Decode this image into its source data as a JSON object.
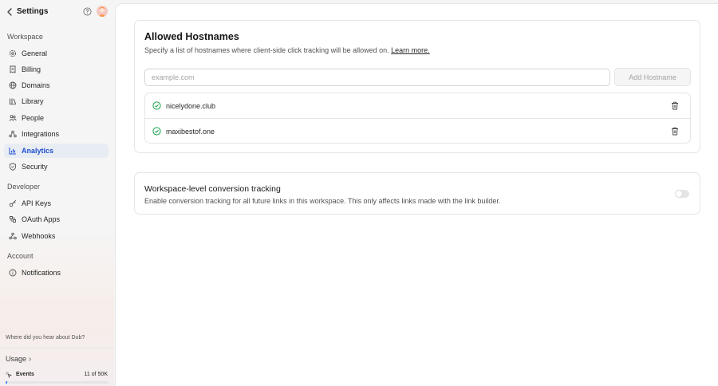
{
  "sidebar": {
    "title": "Settings",
    "sections": {
      "workspace": "Workspace",
      "developer": "Developer",
      "account": "Account"
    },
    "workspace_items": [
      {
        "label": "General",
        "icon": "gear-icon"
      },
      {
        "label": "Billing",
        "icon": "receipt-icon"
      },
      {
        "label": "Domains",
        "icon": "globe-icon"
      },
      {
        "label": "Library",
        "icon": "library-icon"
      },
      {
        "label": "People",
        "icon": "users-icon"
      },
      {
        "label": "Integrations",
        "icon": "integrations-icon"
      },
      {
        "label": "Analytics",
        "icon": "analytics-icon",
        "active": true
      },
      {
        "label": "Security",
        "icon": "shield-icon"
      }
    ],
    "developer_items": [
      {
        "label": "API Keys",
        "icon": "key-icon"
      },
      {
        "label": "OAuth Apps",
        "icon": "oauth-icon"
      },
      {
        "label": "Webhooks",
        "icon": "webhook-icon"
      }
    ],
    "account_items": [
      {
        "label": "Notifications",
        "icon": "bell-icon"
      }
    ],
    "hear_prompt": "Where did you hear about Dub?",
    "usage": {
      "label": "Usage",
      "events_label": "Events",
      "events_count": "11 of 50K",
      "progress_fraction": 0.0002
    }
  },
  "allowed_hostnames": {
    "title": "Allowed Hostnames",
    "description": "Specify a list of hostnames where client-side click tracking will be allowed on.",
    "learn_more": "Learn more.",
    "input_placeholder": "example.com",
    "input_value": "",
    "add_button": "Add Hostname",
    "hosts": [
      "nicelydone.club",
      "maxibestof.one"
    ]
  },
  "conversion_tracking": {
    "title": "Workspace-level conversion tracking",
    "description": "Enable conversion tracking for all future links in this workspace. This only affects links made with the link builder.",
    "enabled": false
  },
  "colors": {
    "accent": "#1f4fd1",
    "active_bg": "#e8ecf3",
    "success": "#16a34a"
  }
}
